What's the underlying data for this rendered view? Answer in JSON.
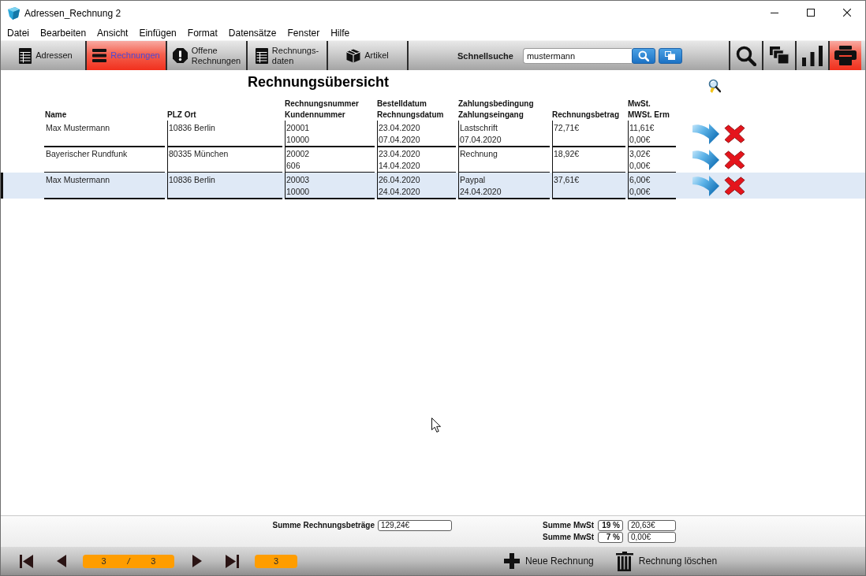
{
  "window": {
    "title": "Adressen_Rechnung 2"
  },
  "menu": [
    "Datei",
    "Bearbeiten",
    "Ansicht",
    "Einfügen",
    "Format",
    "Datensätze",
    "Fenster",
    "Hilfe"
  ],
  "toolbar": {
    "tabs": [
      {
        "lines": [
          "Adressen"
        ],
        "selected": false
      },
      {
        "lines": [
          "Rechnungen"
        ],
        "selected": true
      },
      {
        "lines": [
          "Offene",
          "Rechnungen"
        ],
        "selected": false
      },
      {
        "lines": [
          "Rechnungs-",
          "daten"
        ],
        "selected": false
      },
      {
        "lines": [
          "Artikel"
        ],
        "selected": false
      }
    ],
    "quick_search": {
      "label": "Schnellsuche",
      "value": "mustermann"
    },
    "tools": [
      {
        "active": false
      },
      {
        "active": false
      },
      {
        "active": false
      },
      {
        "active": true
      }
    ]
  },
  "overview": {
    "title": "Rechnungsübersicht",
    "columns": [
      {
        "line_2": "Name"
      },
      {
        "line_2": "PLZ Ort"
      },
      {
        "line_1": "Rechnungsnummer",
        "line_2": "Kundennummer"
      },
      {
        "line_1": "Bestelldatum",
        "line_2": "Rechnungsdatum"
      },
      {
        "line_1": "Zahlungsbedingung",
        "line_2": "Zahlungseingang"
      },
      {
        "line_2": "Rechnungsbetrag"
      },
      {
        "line_1": "MwSt.",
        "line_2": "MWSt. Erm"
      }
    ],
    "rows": [
      {
        "selected": false,
        "cells": [
          [
            "Max Mustermann"
          ],
          [
            "10836 Berlin"
          ],
          [
            "20001",
            "10000"
          ],
          [
            "23.04.2020",
            "07.04.2020"
          ],
          [
            "Lastschrift",
            "07.04.2020"
          ],
          [
            "72,71€"
          ],
          [
            "11,61€",
            "0,00€"
          ]
        ]
      },
      {
        "selected": false,
        "cells": [
          [
            "Bayerischer Rundfunk"
          ],
          [
            "80335 München"
          ],
          [
            "20002",
            "606"
          ],
          [
            "23.04.2020",
            "14.04.2020"
          ],
          [
            "Rechnung"
          ],
          [
            "18,92€"
          ],
          [
            "3,02€",
            "0,00€"
          ]
        ]
      },
      {
        "selected": true,
        "cells": [
          [
            "Max Mustermann"
          ],
          [
            "10836 Berlin"
          ],
          [
            "20003",
            "10000"
          ],
          [
            "26.04.2020",
            "24.04.2020"
          ],
          [
            "Paypal",
            "24.04.2020"
          ],
          [
            "37,61€"
          ],
          [
            "6,00€",
            "0,00€"
          ]
        ]
      }
    ]
  },
  "totals": {
    "invoice_sum": {
      "label": "Summe Rechnungsbeträge",
      "value": "129,24€"
    },
    "vat": [
      {
        "label": "Summe MwSt",
        "rate": "19 %",
        "value": "20,63€"
      },
      {
        "label": "Summe MwSt",
        "rate": "7 %",
        "value": "0,00€"
      }
    ]
  },
  "navigation": {
    "current": "3",
    "separator": "/",
    "total": "3",
    "count": "3"
  },
  "actions": [
    "Neue Rechnung",
    "Rechnung löschen"
  ]
}
